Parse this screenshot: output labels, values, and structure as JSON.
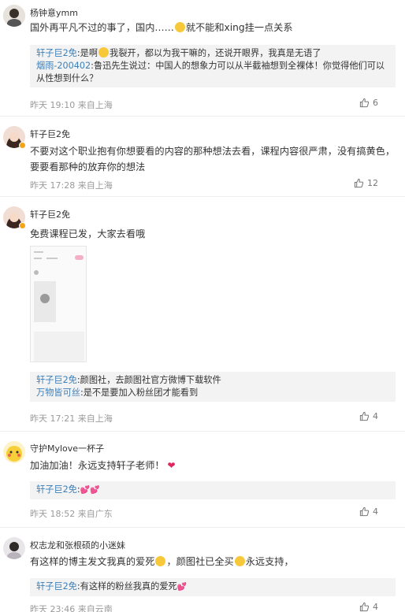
{
  "comments": [
    {
      "username": "杨钟意ymm",
      "text_a": "国外再平凡不过的事了，国内……",
      "text_b": "就不能和xing挂一点关系",
      "replies": [
        {
          "name": "轩子巨2免",
          "text_a": ":是啊",
          "text_b": "我裂开，都以为我干嘛的，还说开眼界，我真是无语了"
        },
        {
          "name": "烟雨-200402",
          "text_a": ":鲁迅先生说过：中国人的想象力可以从半截袖想到全裸体！你觉得他们可以从性想到什么？"
        }
      ],
      "time": "昨天 19:10 来自上海",
      "likes": "6"
    },
    {
      "username": "轩子巨2免",
      "text": "不要对这个职业抱有你想要看的内容的那种想法去看，课程内容很严肃，没有搞黄色，要要看那种的放弃你的想法",
      "time": "昨天 17:28 来自上海",
      "likes": "12"
    },
    {
      "username": "轩子巨2免",
      "text": "免费课程已发，大家去看哦",
      "replies": [
        {
          "name": "轩子巨2免",
          "text_a": ":颜图社，去颜图社官方微博下载软件"
        },
        {
          "name": "万物皆可丝",
          "text_a": ":是不是要加入粉丝团才能看到"
        }
      ],
      "time": "昨天 17:21 来自上海",
      "likes": "4"
    },
    {
      "username": "守护Mylove一杯子",
      "text_a": "加油加油！永远支持轩子老师！",
      "replies": [
        {
          "name": "轩子巨2免",
          "text_a": ":"
        }
      ],
      "time": "昨天 18:52 来自广东",
      "likes": "4"
    },
    {
      "username": "权志龙和张根硕的小迷妹",
      "text_a": "有这样的博主发文我真的爱死",
      "text_b": "，颜图社已全买",
      "text_c": "永远支持，",
      "replies": [
        {
          "name": "轩子巨2免",
          "text_a": ":有这样的粉丝我真的爱死"
        }
      ],
      "time": "昨天 23:46 来自云南",
      "likes": "4"
    }
  ],
  "colors": {
    "link": "#3d7fb8",
    "meta": "#9a9a9a",
    "reply_bg": "#f3f3f3",
    "heart": "#e0245e"
  },
  "icons": {
    "like": "thumbs-up-icon",
    "verified": "verified-badge-icon",
    "emoji": "emoji-icon"
  }
}
